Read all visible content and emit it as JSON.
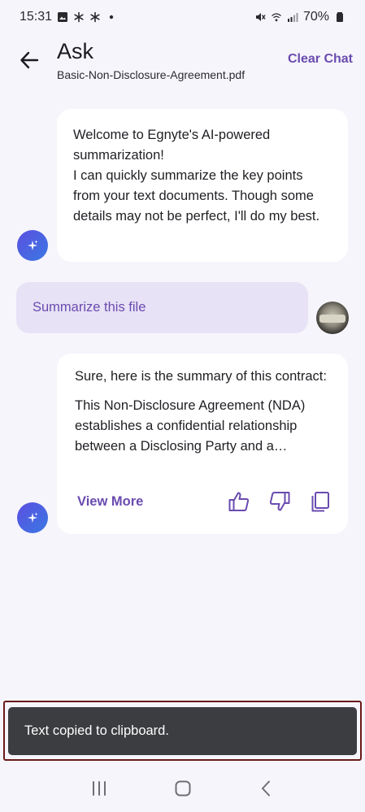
{
  "status_bar": {
    "time": "15:31",
    "battery": "70%",
    "icons": [
      "image-icon",
      "asterisk-icon",
      "asterisk-icon",
      "dot-icon",
      "mute-icon",
      "wifi-icon",
      "signal-icon",
      "battery-icon"
    ]
  },
  "header": {
    "title": "Ask",
    "subtitle": "Basic-Non-Disclosure-Agreement.pdf",
    "clear_chat": "Clear Chat"
  },
  "messages": {
    "welcome": "Welcome to Egnyte's AI-powered summarization!\nI can quickly summarize the key points from your text documents. Though some details may not be perfect, I'll do my best.",
    "user_prompt": "Summarize this file",
    "reply_intro": "Sure, here is the summary of this contract:",
    "reply_summary": "This Non-Disclosure Agreement (NDA) establishes a confidential relationship between a Disclosing Party and a Receiving Party",
    "view_more": "View More"
  },
  "snackbar": {
    "text": "Text copied to clipboard."
  },
  "colors": {
    "accent": "#6a4bb0",
    "background": "#f6f5fb",
    "user_bubble": "#e7e2f5",
    "snackbar": "#3b3d40"
  }
}
